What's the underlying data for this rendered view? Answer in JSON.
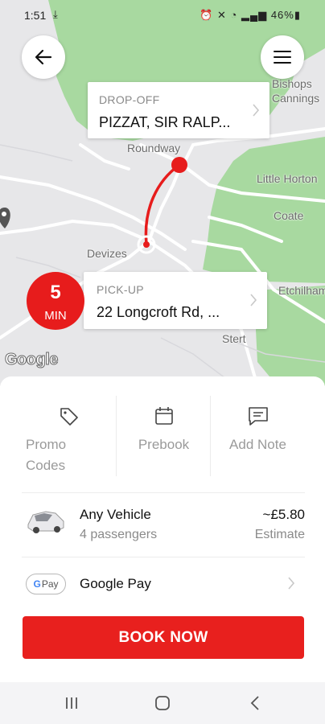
{
  "status_bar": {
    "time": "1:51",
    "download_icon": "download-icon",
    "indicators": "⏰ ✕ ◔ ▂▄▆ 46%▮"
  },
  "map": {
    "places": [
      "Bishops",
      "Cannings",
      "Roundway",
      "Little Horton",
      "Coate",
      "Devizes",
      "Etchilham",
      "Stert"
    ],
    "attribution": "Google"
  },
  "dropoff": {
    "label": "DROP-OFF",
    "address": "PIZZAT, SIR RALP..."
  },
  "pickup": {
    "label": "PICK-UP",
    "address": "22 Longcroft Rd, ...",
    "eta_number": "5",
    "eta_unit": "MIN"
  },
  "actions": [
    {
      "label": "Promo Codes",
      "icon": "tag-icon"
    },
    {
      "label": "Prebook",
      "icon": "calendar-icon"
    },
    {
      "label": "Add Note",
      "icon": "note-icon"
    }
  ],
  "vehicle": {
    "name": "Any Vehicle",
    "capacity": "4 passengers",
    "price": "~£5.80",
    "price_note": "Estimate"
  },
  "payment": {
    "badge": "Pay",
    "method": "Google Pay"
  },
  "book_button": "BOOK NOW",
  "colors": {
    "accent": "#e8201e",
    "map_green": "#a8d9a0",
    "map_land": "#e7e7e9"
  }
}
